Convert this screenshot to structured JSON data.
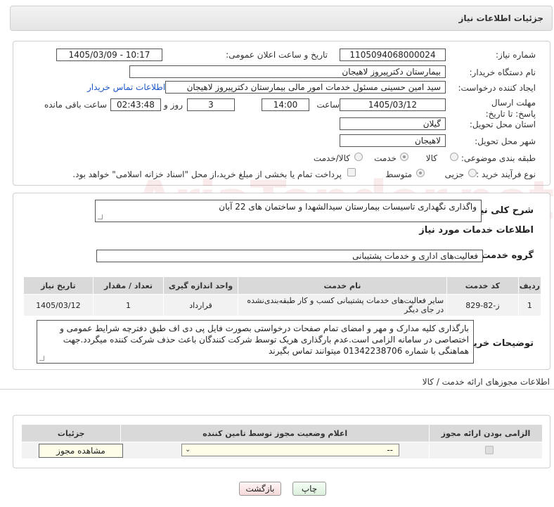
{
  "header": {
    "title": "جزئیات اطلاعات نیاز"
  },
  "watermark": "AriaTender.net",
  "form": {
    "need_number_label": "شماره نیاز:",
    "need_number": "1105094068000024",
    "announce_label": "تاریخ و ساعت اعلان عمومی:",
    "announce_value": "1405/03/09 - 10:17",
    "buyer_org_label": "نام دستگاه خریدار:",
    "buyer_org": "بیمارستان دکترپیروز لاهیجان",
    "creator_label": "ایجاد کننده درخواست:",
    "creator": "سید امین حسینی مسئول خدمات امور مالی بیمارستان دکترپیروز لاهیجان",
    "contact_link": "اطلاعات تماس خریدار",
    "deadline_label": "مهلت ارسال پاسخ: تا تاریخ:",
    "deadline_date": "1405/03/12",
    "time_label": "ساعت",
    "deadline_time": "14:00",
    "days_value": "3",
    "days_label": "روز و",
    "remaining_time": "02:43:48",
    "remaining_label": "ساعت باقی مانده",
    "province_label": "استان محل تحویل:",
    "province": "گیلان",
    "city_label": "شهر محل تحویل:",
    "city": "لاهیجان",
    "category_label": "طبقه بندی موضوعی:",
    "category_options": [
      "کالا",
      "خدمت",
      "کالا/خدمت"
    ],
    "category_selected": "خدمت",
    "process_label": "نوع فرآیند خرید :",
    "process_options": [
      "جزیی",
      "متوسط"
    ],
    "process_selected": "متوسط",
    "payment_note": "پرداخت تمام یا بخشی از مبلغ خرید،از محل \"اسناد خزانه اسلامی\" خواهد بود."
  },
  "summary": {
    "label": "شرح کلی نیاز:",
    "text": "واگذاری نگهداری تاسیسات بیمارستان سیدالشهدا و ساختمان های 22 آبان"
  },
  "services": {
    "section_title": "اطلاعات خدمات مورد نیاز",
    "group_label": "گروه خدمت:",
    "group_value": "فعالیت‌های اداری و خدمات پشتیبانی",
    "columns": [
      "ردیف",
      "کد خدمت",
      "نام خدمت",
      "واحد اندازه گیری",
      "تعداد / مقدار",
      "تاریخ نیاز"
    ],
    "rows": [
      {
        "index": "1",
        "code": "ز-82-829",
        "name": "سایر فعالیت‌های خدمات پشتیبانی کسب و کار طبقه‌بندی‌نشده در جای دیگر",
        "unit": "قرارداد",
        "qty": "1",
        "date": "1405/03/12"
      }
    ]
  },
  "buyer_notes": {
    "label": "توضیحات خریدار:",
    "text": "بارگذاری کلیه مدارک  و مهر و امضای تمام صفحات درخواستی بصورت فایل پی دی اف طبق دفترچه شرایط عمومی و اختصاصی در سامانه الزامی است.عدم بارگذاری هریک توسط شرکت کنندگان باعث حذف شرکت کننده میگردد.جهت هماهنگی با شماره 01342238706 میتوانند تماس بگیرند"
  },
  "permits": {
    "section_title": "اطلاعات مجوزهای ارائه خدمت / کالا",
    "columns": [
      "الزامی بودن ارائه مجوز",
      "اعلام وضعیت مجوز توسط تامین کننده",
      "جزئیات"
    ],
    "select_value": "--",
    "view_button": "مشاهده مجوز"
  },
  "actions": {
    "print": "چاپ",
    "back": "بازگشت"
  }
}
